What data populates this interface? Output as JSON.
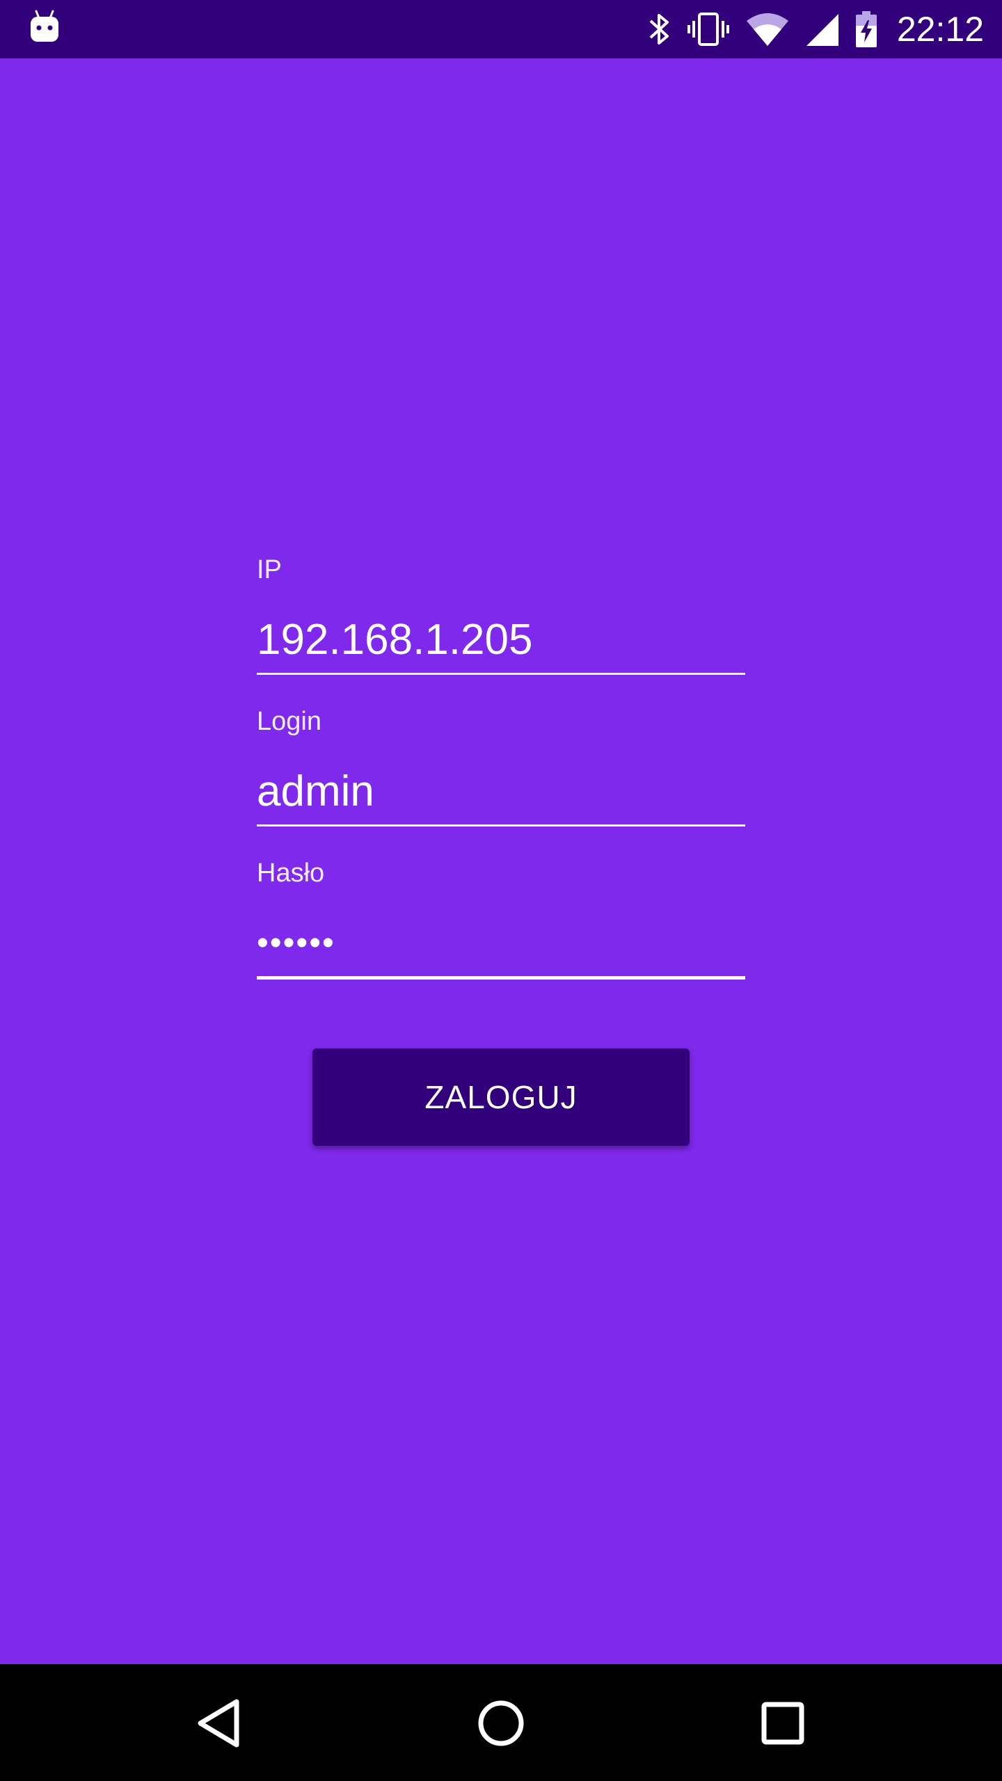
{
  "status_bar": {
    "time": "22:12",
    "icons": [
      "android-notification-icon",
      "bluetooth-icon",
      "vibrate-icon",
      "wifi-icon",
      "signal-icon",
      "battery-charging-icon"
    ],
    "background_color": "#31007a"
  },
  "login_form": {
    "ip": {
      "label": "IP",
      "value": "192.168.1.205"
    },
    "login": {
      "label": "Login",
      "value": "admin"
    },
    "password": {
      "label": "Hasło",
      "value": "••••••"
    },
    "submit_label": "ZALOGUJ"
  },
  "nav_bar": {
    "icons": [
      "back-icon",
      "home-icon",
      "recents-icon"
    ]
  },
  "colors": {
    "background": "#7f29ec",
    "button": "#31007a",
    "text": "#ffffff"
  }
}
